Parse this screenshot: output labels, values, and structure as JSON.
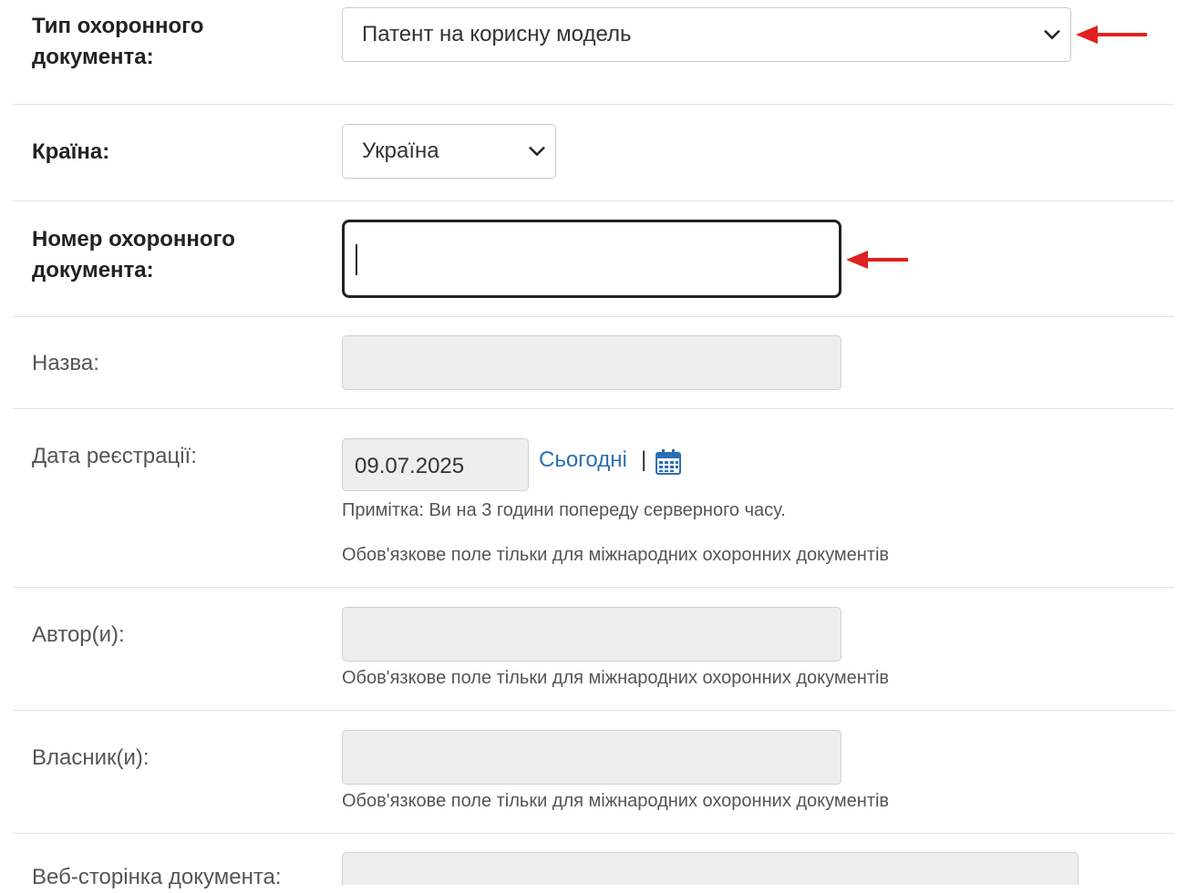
{
  "fields": {
    "doc_type": {
      "label": "Тип охоронного документа:",
      "value": "Патент на корисну модель"
    },
    "country": {
      "label": "Країна:",
      "value": "Україна"
    },
    "doc_number": {
      "label": "Номер охоронного документа:",
      "value": ""
    },
    "title": {
      "label": "Назва:",
      "value": ""
    },
    "reg_date": {
      "label": "Дата реєстрації:",
      "value": "09.07.2025",
      "today_link": "Сьогодні",
      "separator": "|",
      "note_time": "Примітка: Ви на 3 години попереду серверного часу.",
      "note_required": "Обов'язкове поле тільки для міжнародних охоронних документів"
    },
    "authors": {
      "label": "Автор(и):",
      "value": "",
      "note_required": "Обов'язкове поле тільки для міжнародних охоронних документів"
    },
    "owners": {
      "label": "Власник(и):",
      "value": "",
      "note_required": "Обов'язкове поле тільки для міжнародних охоронних документів"
    },
    "web_page": {
      "label": "Веб-сторінка документа:",
      "value": ""
    }
  },
  "icons": {
    "calendar": "calendar-icon",
    "arrow": "red-arrow-left-icon",
    "chevron": "chevron-down-icon"
  },
  "colors": {
    "link": "#2a6fb3",
    "arrow": "#e02020",
    "focus_border": "#222222"
  }
}
